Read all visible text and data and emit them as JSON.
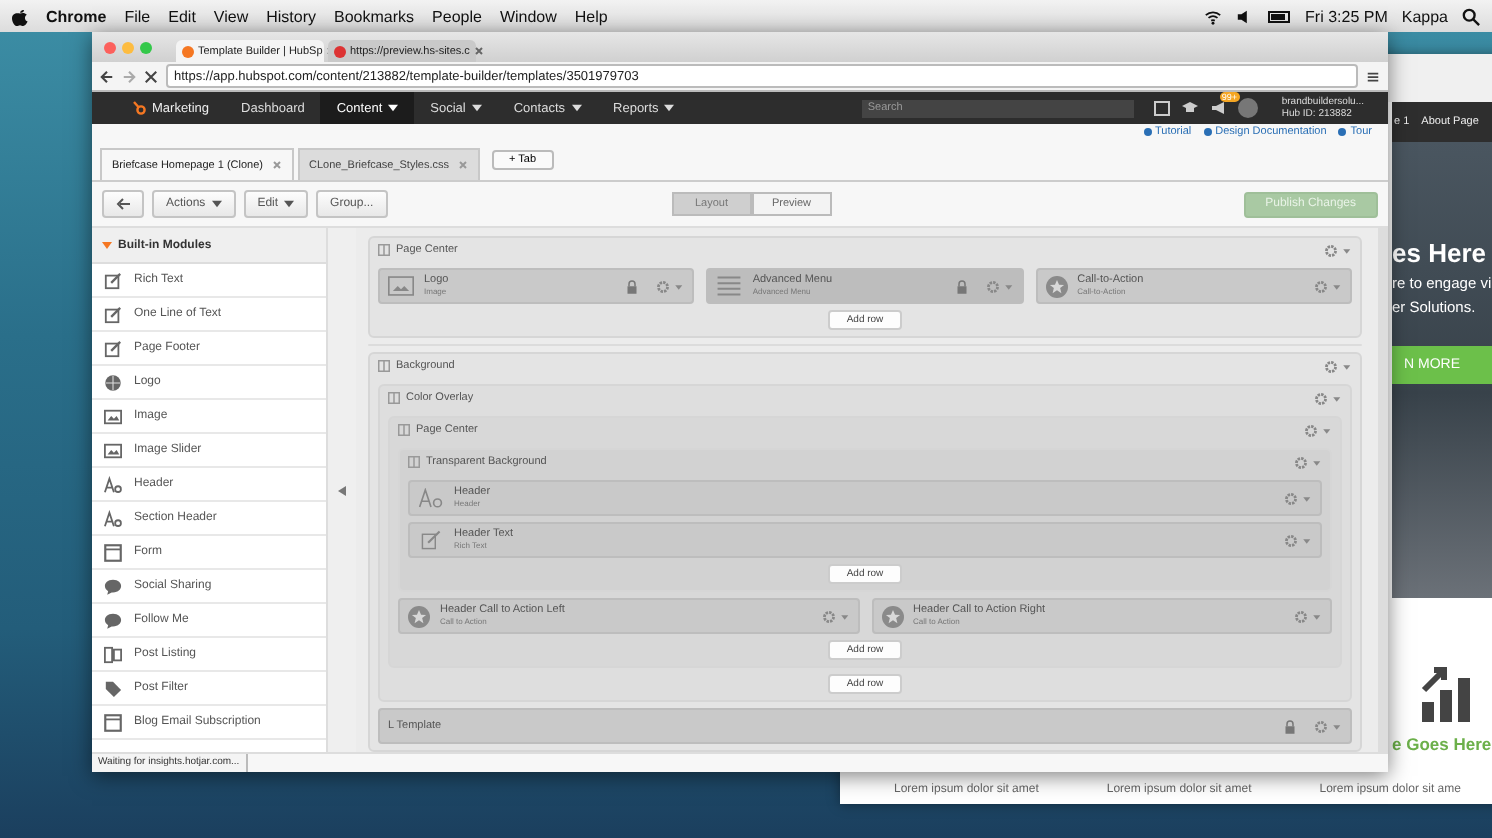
{
  "menubar": {
    "app": "Chrome",
    "menus": [
      "File",
      "Edit",
      "View",
      "History",
      "Bookmarks",
      "People",
      "Window",
      "Help"
    ],
    "clock": "Fri 3:25 PM",
    "user": "Kappa"
  },
  "browser": {
    "tabs": [
      {
        "label": "Template Builder | HubSp",
        "selected": true
      },
      {
        "label": "https://preview.hs-sites.c",
        "selected": false
      }
    ],
    "url": "https://app.hubspot.com/content/213882/template-builder/templates/3501979703"
  },
  "nav": {
    "brand": "Marketing",
    "items": [
      {
        "label": "Dashboard",
        "selected": false,
        "dropdown": false
      },
      {
        "label": "Content",
        "selected": true,
        "dropdown": true
      },
      {
        "label": "Social",
        "selected": false,
        "dropdown": true
      },
      {
        "label": "Contacts",
        "selected": false,
        "dropdown": true
      },
      {
        "label": "Reports",
        "selected": false,
        "dropdown": true
      }
    ],
    "search_placeholder": "Search",
    "notification_count": "99+",
    "account_name": "brandbuildersolu...",
    "hub_id": "Hub ID: 213882"
  },
  "help_links": [
    "Tutorial",
    "Design Documentation",
    "Tour"
  ],
  "editor_tabs": [
    {
      "label": "Briefcase Homepage 1 (Clone)",
      "selected": true
    },
    {
      "label": "CLone_Briefcase_Styles.css",
      "selected": false
    }
  ],
  "new_tab": "+ Tab",
  "toolbar": {
    "menus": [
      {
        "label": "Actions",
        "dropdown": true
      },
      {
        "label": "Edit",
        "dropdown": true
      },
      {
        "label": "Group...",
        "dropdown": false
      }
    ],
    "views": [
      {
        "label": "Layout",
        "selected": true
      },
      {
        "label": "Preview",
        "selected": false
      }
    ],
    "publish": {
      "label": "Publish Changes",
      "disabled": true
    }
  },
  "sidebar": {
    "title": "Built-in Modules",
    "expanded": true,
    "items": [
      {
        "label": "Rich Text",
        "kind": "edit"
      },
      {
        "label": "One Line of Text",
        "kind": "edit"
      },
      {
        "label": "Page Footer",
        "kind": "edit"
      },
      {
        "label": "Logo",
        "kind": "globe"
      },
      {
        "label": "Image",
        "kind": "image"
      },
      {
        "label": "Image Slider",
        "kind": "image"
      },
      {
        "label": "Header",
        "kind": "font"
      },
      {
        "label": "Section Header",
        "kind": "font"
      },
      {
        "label": "Form",
        "kind": "form"
      },
      {
        "label": "Social Sharing",
        "kind": "chat"
      },
      {
        "label": "Follow Me",
        "kind": "chat"
      },
      {
        "label": "Post Listing",
        "kind": "list"
      },
      {
        "label": "Post Filter",
        "kind": "tag"
      },
      {
        "label": "Blog Email Subscription",
        "kind": "form"
      }
    ]
  },
  "canvas": {
    "sections": [
      {
        "kind": "group",
        "title": "Page Center",
        "add_row": "Add row",
        "rows": [
          [
            {
              "kind": "image",
              "title": "Logo",
              "subtitle": "Image",
              "locked": true
            },
            {
              "kind": "menu",
              "title": "Advanced Menu",
              "subtitle": "Advanced Menu",
              "locked": true
            },
            {
              "kind": "cta",
              "title": "Call-to-Action",
              "subtitle": "Call-to-Action",
              "locked": false
            }
          ]
        ]
      },
      {
        "kind": "group",
        "title": "Background",
        "rows": [
          [
            {
              "kind": "group",
              "title": "Color Overlay",
              "add_row": "Add row",
              "rows": [
                [
                  {
                    "kind": "group",
                    "title": "Page Center",
                    "add_row": "Add row",
                    "rows": [
                      [
                        {
                          "kind": "group",
                          "title": "Transparent Background",
                          "add_row": "Add row",
                          "rows": [
                            [
                              {
                                "kind": "header",
                                "title": "Header",
                                "subtitle": "Header",
                                "locked": false
                              }
                            ],
                            [
                              {
                                "kind": "rich_text",
                                "title": "Header Text",
                                "subtitle": "Rich Text",
                                "locked": false
                              }
                            ]
                          ]
                        }
                      ],
                      [
                        {
                          "kind": "cta",
                          "title": "Header Call to Action Left",
                          "subtitle": "Call to Action",
                          "locked": false
                        },
                        {
                          "kind": "cta",
                          "title": "Header Call to Action Right",
                          "subtitle": "Call to Action",
                          "locked": false
                        }
                      ]
                    ]
                  }
                ]
              ]
            }
          ],
          [
            {
              "kind": "template",
              "title": "L Template",
              "locked": true
            }
          ]
        ]
      }
    ]
  },
  "status_text": "Waiting for insights.hotjar.com...",
  "background_page": {
    "nav": [
      "e 1",
      "About Page"
    ],
    "headline": "es Here",
    "lines": [
      "re to engage vi",
      "er Solutions."
    ],
    "button": "N MORE",
    "feature_title": "e Goes Here",
    "footer": [
      "Lorem ipsum dolor sit amet",
      "Lorem ipsum dolor sit amet",
      "Lorem ipsum dolor sit ame"
    ]
  }
}
